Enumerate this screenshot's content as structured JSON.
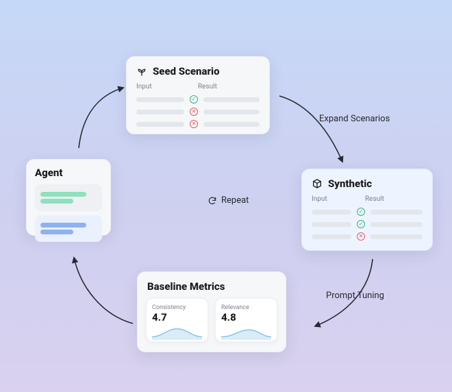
{
  "agent": {
    "title": "Agent"
  },
  "seed": {
    "title": "Seed Scenario",
    "headers": {
      "input": "Input",
      "result": "Result"
    },
    "rows": [
      {
        "status": "ok"
      },
      {
        "status": "err"
      },
      {
        "status": "err"
      }
    ]
  },
  "synthetic": {
    "title": "Synthetic",
    "headers": {
      "input": "Input",
      "result": "Result"
    },
    "rows": [
      {
        "status": "ok"
      },
      {
        "status": "ok"
      },
      {
        "status": "err"
      }
    ]
  },
  "baseline": {
    "title": "Baseline Metrics",
    "metrics": [
      {
        "label": "Consistency",
        "value": "4.7"
      },
      {
        "label": "Relevance",
        "value": "4.8"
      }
    ]
  },
  "flow": {
    "expand": "Expand Scenarios",
    "repeat": "Repeat",
    "prompt": "Prompt Tuning"
  },
  "icons": {
    "sprout": "sprout-icon",
    "cube": "cube-icon",
    "refresh": "refresh-icon"
  }
}
